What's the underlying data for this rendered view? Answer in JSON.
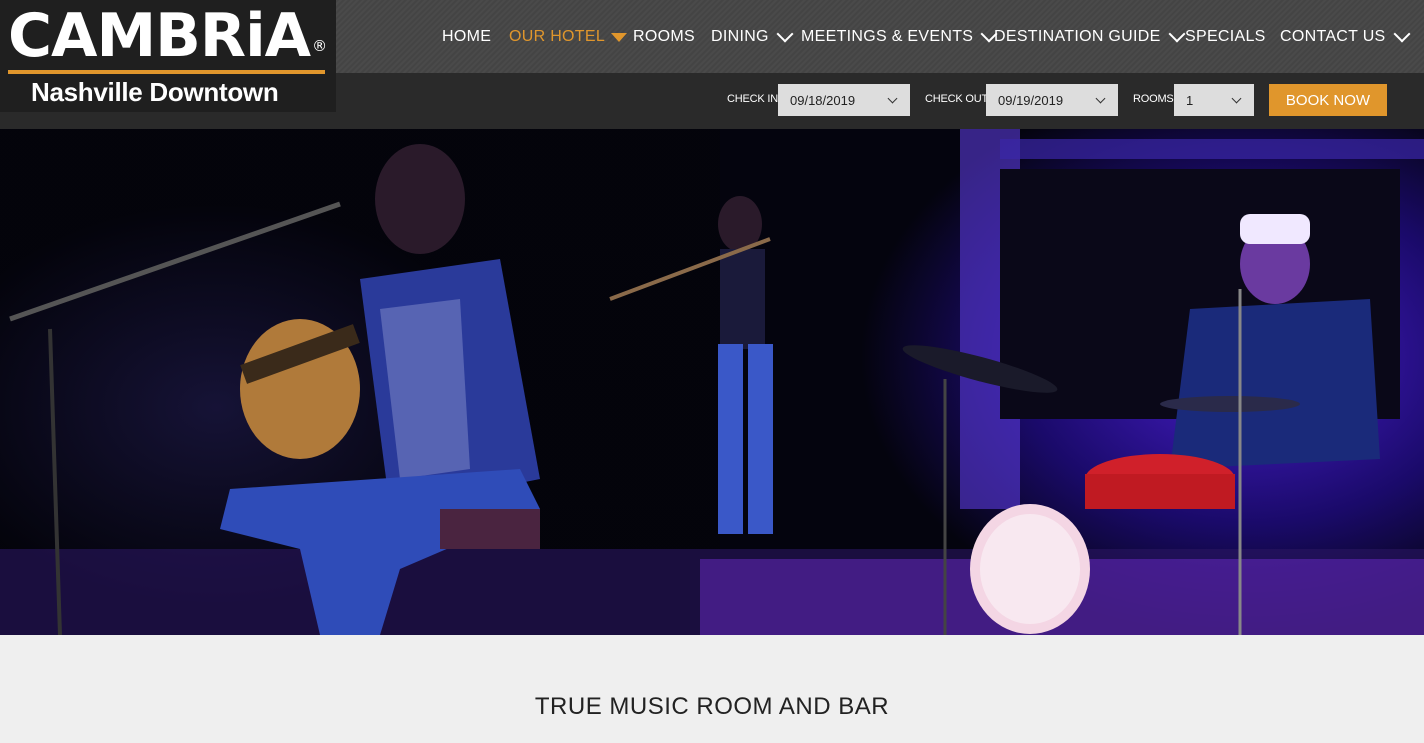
{
  "brand": {
    "name": "CAMBRiA",
    "registered": "®",
    "location": "Nashville Downtown"
  },
  "nav": {
    "items": [
      {
        "label": "HOME",
        "dropdown": false
      },
      {
        "label": "OUR HOTEL",
        "dropdown": true,
        "active": true
      },
      {
        "label": "ROOMS",
        "dropdown": false
      },
      {
        "label": "DINING",
        "dropdown": true
      },
      {
        "label": "MEETINGS & EVENTS",
        "dropdown": true
      },
      {
        "label": "DESTINATION GUIDE",
        "dropdown": true
      },
      {
        "label": "SPECIALS",
        "dropdown": false
      },
      {
        "label": "CONTACT US",
        "dropdown": true
      }
    ]
  },
  "booking": {
    "check_in_label": "CHECK IN",
    "check_in_value": "09/18/2019",
    "check_out_label": "CHECK OUT",
    "check_out_value": "09/19/2019",
    "rooms_label": "ROOMS",
    "rooms_value": "1",
    "book_label": "BOOK NOW"
  },
  "section": {
    "title": "TRUE MUSIC ROOM AND BAR"
  },
  "colors": {
    "accent": "#e0962c",
    "header_bg": "#2a2a2a",
    "page_bg": "#efefef"
  }
}
